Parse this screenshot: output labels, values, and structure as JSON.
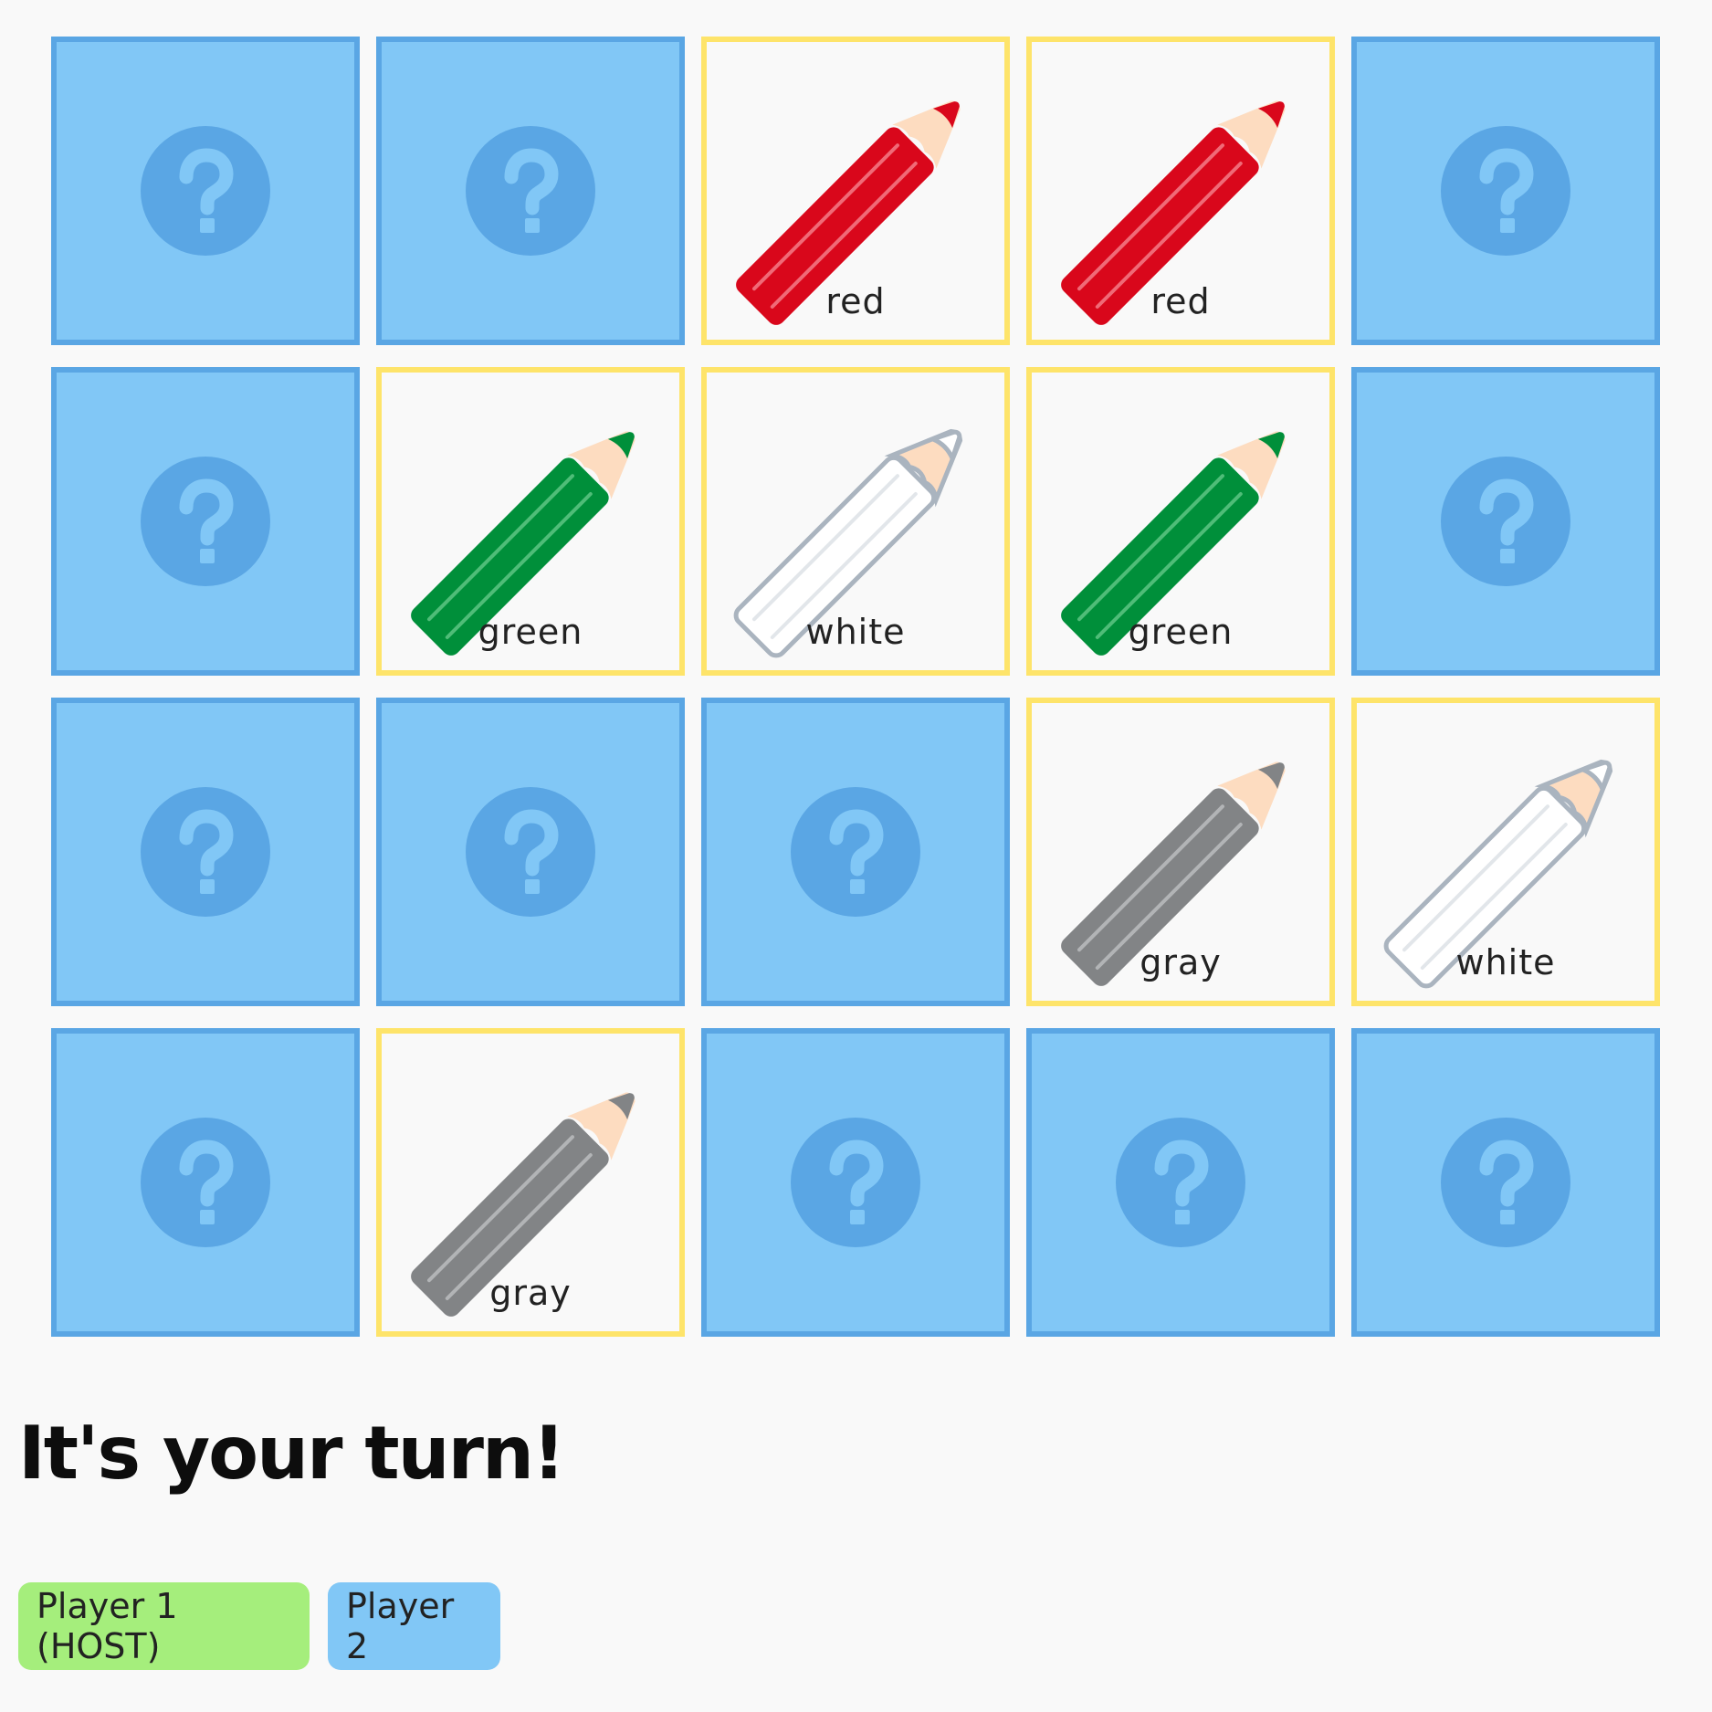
{
  "colors": {
    "background": "#f9f9f9",
    "hidden_card_fill": "#81c7f6",
    "hidden_card_border": "#5aa6e4",
    "revealed_card_border": "#fee46a",
    "question_circle": "#5aa6e4",
    "question_mark": "#81c7f6"
  },
  "board": {
    "rows": 4,
    "columns": 5,
    "cards": [
      {
        "state": "hidden"
      },
      {
        "state": "hidden"
      },
      {
        "state": "revealed",
        "label": "red",
        "icon": "red-pencil-icon"
      },
      {
        "state": "revealed",
        "label": "red",
        "icon": "red-pencil-icon"
      },
      {
        "state": "hidden"
      },
      {
        "state": "hidden"
      },
      {
        "state": "revealed",
        "label": "green",
        "icon": "green-pencil-icon"
      },
      {
        "state": "revealed",
        "label": "white",
        "icon": "white-pencil-icon"
      },
      {
        "state": "revealed",
        "label": "green",
        "icon": "green-pencil-icon"
      },
      {
        "state": "hidden"
      },
      {
        "state": "hidden"
      },
      {
        "state": "hidden"
      },
      {
        "state": "hidden"
      },
      {
        "state": "revealed",
        "label": "gray",
        "icon": "gray-pencil-icon"
      },
      {
        "state": "revealed",
        "label": "white",
        "icon": "white-pencil-icon"
      },
      {
        "state": "hidden"
      },
      {
        "state": "revealed",
        "label": "gray",
        "icon": "gray-pencil-icon"
      },
      {
        "state": "hidden"
      },
      {
        "state": "hidden"
      },
      {
        "state": "hidden"
      }
    ]
  },
  "pencil_colors": {
    "red": {
      "body": "#d9071b",
      "tip": "#d9071b",
      "stripe": "#f06a77",
      "outline": "none"
    },
    "green": {
      "body": "#008f3a",
      "tip": "#008f3a",
      "stripe": "#4fbd78",
      "outline": "none"
    },
    "white": {
      "body": "#ffffff",
      "tip": "#ffffff",
      "stripe": "#e2e6ea",
      "outline": "#aab4bf"
    },
    "gray": {
      "body": "#828486",
      "tip": "#828486",
      "stripe": "#b2b4b6",
      "outline": "none"
    }
  },
  "status": {
    "turn_message": "It's your turn!"
  },
  "players": [
    {
      "label": "Player 1 (HOST)",
      "color": "#a5ee7c"
    },
    {
      "label": "Player 2",
      "color": "#81c7f6"
    }
  ]
}
